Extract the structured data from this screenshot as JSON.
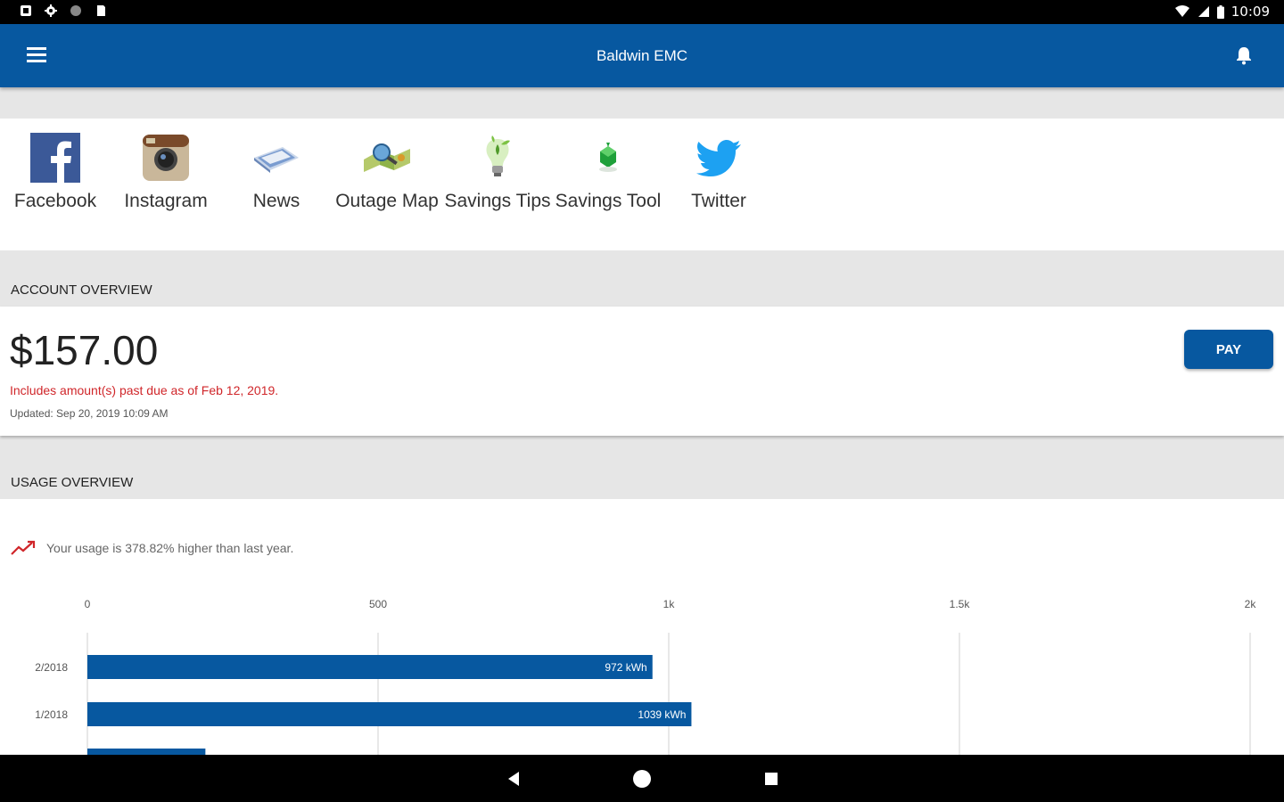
{
  "status_bar": {
    "time": "10:09",
    "left_icons": [
      "notification-icon",
      "settings-icon",
      "circle-icon",
      "sim-icon"
    ],
    "right_icons": [
      "wifi-icon",
      "signal-icon",
      "battery-icon"
    ]
  },
  "app_bar": {
    "title": "Baldwin EMC",
    "menu_icon": "hamburger-menu-icon",
    "notification_icon": "bell-icon"
  },
  "quick_links": [
    {
      "label": "Facebook",
      "icon": "facebook-icon",
      "color": "#3b5998"
    },
    {
      "label": "Instagram",
      "icon": "instagram-icon",
      "color": "#8a5a3b"
    },
    {
      "label": "News",
      "icon": "news-icon",
      "color": "#6f8fbf"
    },
    {
      "label": "Outage Map",
      "icon": "outage-map-icon",
      "color": "#4a90c0"
    },
    {
      "label": "Savings Tips",
      "icon": "lightbulb-icon",
      "color": "#7cc243"
    },
    {
      "label": "Savings Tool",
      "icon": "savings-tool-icon",
      "color": "#1fa03a"
    },
    {
      "label": "Twitter",
      "icon": "twitter-icon",
      "color": "#1da1f2"
    }
  ],
  "account_overview": {
    "header": "ACCOUNT OVERVIEW",
    "amount": "$157.00",
    "past_due_note": "Includes amount(s) past due as of Feb 12, 2019.",
    "updated": "Updated:  Sep 20, 2019 10:09 AM",
    "pay_label": "PAY"
  },
  "usage_overview": {
    "header": "USAGE OVERVIEW",
    "note": "Your usage is 378.82% higher than last year.",
    "trend_icon": "trending-up-icon"
  },
  "chart_data": {
    "type": "bar",
    "orientation": "horizontal",
    "x_ticks": [
      "0",
      "500",
      "1k",
      "1.5k",
      "2k"
    ],
    "xlim": [
      0,
      2000
    ],
    "categories": [
      "2/2018",
      "1/2018",
      ""
    ],
    "values": [
      972,
      1039,
      203
    ],
    "value_labels": [
      "972 kWh",
      "1039 kWh",
      ""
    ],
    "unit": "kWh",
    "bar_color": "#0758a0",
    "grid": true
  },
  "nav_bar": {
    "buttons": [
      "back-icon",
      "home-icon",
      "recents-icon"
    ]
  },
  "colors": {
    "primary": "#0758a0",
    "alert": "#d0262a"
  }
}
